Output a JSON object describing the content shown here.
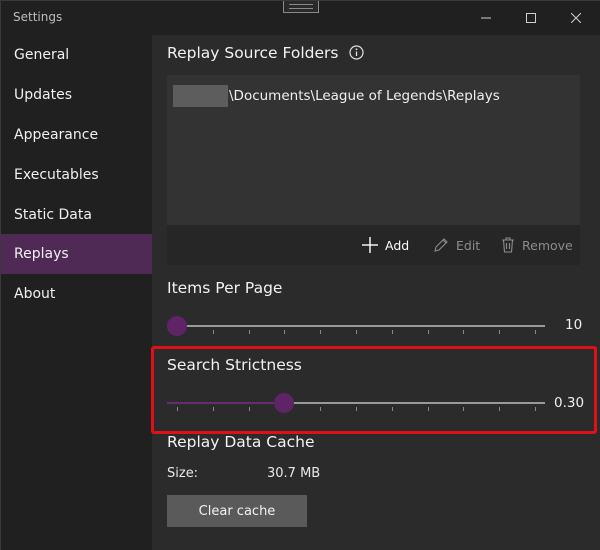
{
  "window": {
    "title": "Settings"
  },
  "sidebar": {
    "items": [
      {
        "label": "General",
        "active": false
      },
      {
        "label": "Updates",
        "active": false
      },
      {
        "label": "Appearance",
        "active": false
      },
      {
        "label": "Executables",
        "active": false
      },
      {
        "label": "Static Data",
        "active": false
      },
      {
        "label": "Replays",
        "active": true
      },
      {
        "label": "About",
        "active": false
      }
    ]
  },
  "replay_source": {
    "title": "Replay Source Folders",
    "folder_path": "\\Documents\\League of Legends\\Replays",
    "actions": {
      "add": "Add",
      "edit": "Edit",
      "remove": "Remove"
    }
  },
  "items_per_page": {
    "title": "Items Per Page",
    "value_label": "10",
    "fraction": 0.0
  },
  "search_strictness": {
    "title": "Search Strictness",
    "value_label": "0.30",
    "fraction": 0.3
  },
  "cache": {
    "title": "Replay Data Cache",
    "size_label": "Size:",
    "size_value": "30.7 MB",
    "clear_label": "Clear cache"
  },
  "colors": {
    "accent": "#5e2466",
    "active_nav": "#4e2a55",
    "highlight": "#e0101a"
  }
}
